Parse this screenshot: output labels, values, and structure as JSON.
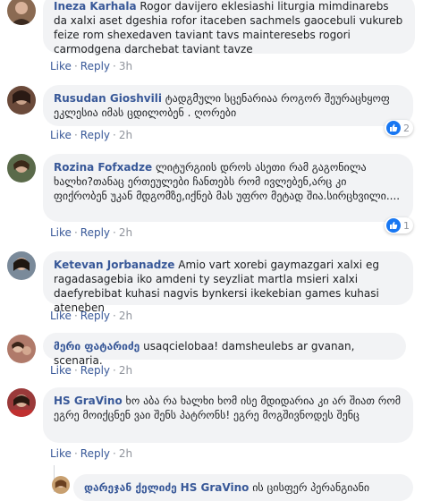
{
  "comments": [
    {
      "name": "Ineza Karhala",
      "text": "Rogor davijero eklesiashi liturgia mimdinarebs da xalxi aset dgeshia rofor itaceben sachmels gaocebuli vukureb feize rom shexedaven taviant tavs mainteresebs rogori carmodgena darchebat taviant tavze",
      "like": "Like",
      "reply": "Reply",
      "time": "3h"
    },
    {
      "name": "Rusudan Gioshvili",
      "text": "ტადგმული სცენარიაა როგორ შეურაცხყოფ ეკლესია იმას ცდილობენ . ღორები",
      "like": "Like",
      "reply": "Reply",
      "time": "2h",
      "reactions": "2"
    },
    {
      "name": "Rozina Fofxadze",
      "text": "ლიტურგიის დროს ასეთი რამ გაგონილა ხალხი?თანაც ერთეულები ჩანთებს რომ ივლებენ,არც კი ფიქრობენ უკან მდგომზე,იქნებ მას უფრო მეტად შია.სირცხვილი....",
      "like": "Like",
      "reply": "Reply",
      "time": "2h",
      "reactions": "1"
    },
    {
      "name": "Ketevan Jorbanadze",
      "text": "Amio vart xorebi gaymazgari xalxi eg ragadasagebia iko amdeni ty seyzliat martla msieri xalxi daefyrebibat kuhasi nagvis bynkersi ikekebian games kuhasi ateneben",
      "like": "Like",
      "reply": "Reply",
      "time": "2h"
    },
    {
      "name": "მერი ფატარიძე",
      "text": "usaqcielobaa! damsheulebs ar gvanan, scenaria.",
      "like": "Like",
      "reply": "Reply",
      "time": "2h"
    },
    {
      "name": "HS GraVino",
      "text": "ხო აბა რა ხალხი ხომ ისე მდიდარია კი არ შიათ რომ ეგრე მოიქცნენ ვაი შენს პატრონს! ეგრე მოგშივნოდეს შენც",
      "like": "Like",
      "reply": "Reply",
      "time": "2h"
    }
  ],
  "reply": {
    "name": "დარეჯან ქელიძე",
    "mention": "HS GraVino",
    "text": "ის ცისფერ პერანგიანი"
  },
  "colors": {
    "link": "#385898",
    "bubble": "#f2f3f5",
    "meta": "#90949c",
    "like_badge": "#1877f2"
  }
}
